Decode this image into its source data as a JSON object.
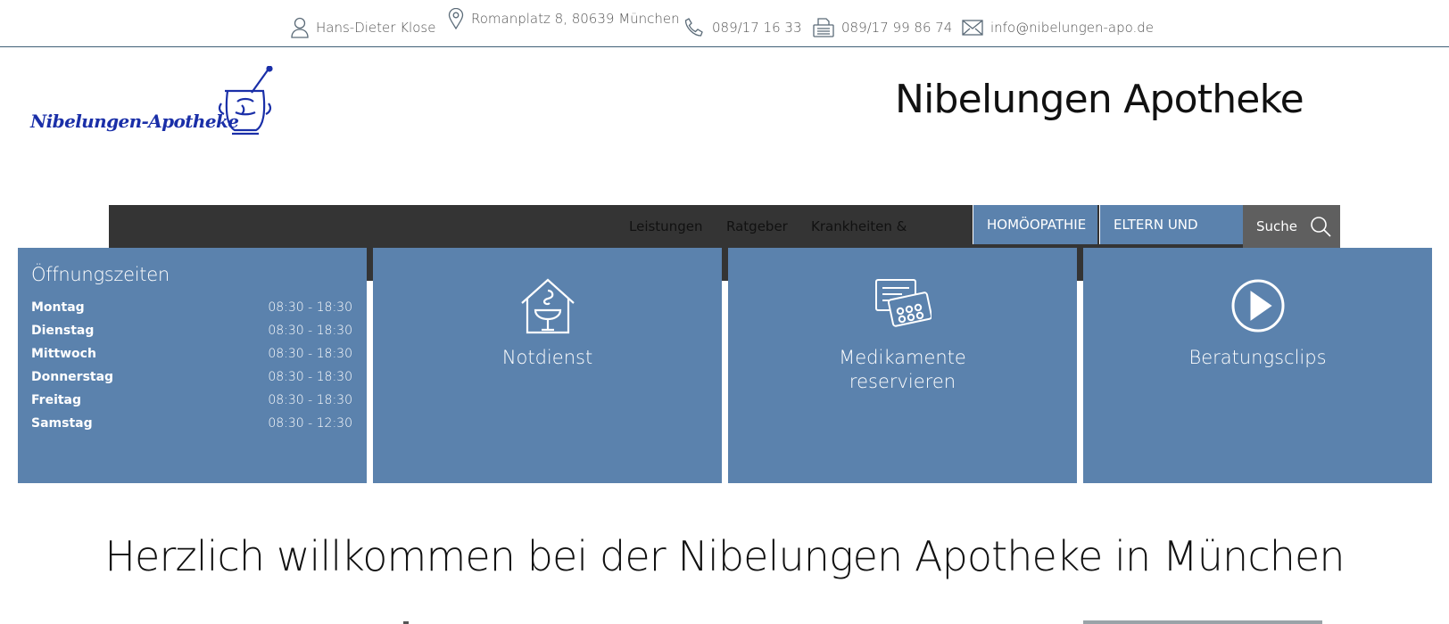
{
  "contact": {
    "name": "Hans-Dieter Klose",
    "address": "Romanplatz 8, 80639 München",
    "phone": "089/17 16 33",
    "fax": "089/17 99 86 74",
    "email": "info@nibelungen-apo.de"
  },
  "logo": {
    "text": "Nibelungen-Apotheke"
  },
  "header": {
    "title": "Nibelungen Apotheke"
  },
  "nav": {
    "links": [
      "Leistungen",
      "Ratgeber",
      "Krankheiten &"
    ],
    "tabs": [
      "HOMÖOPATHIE",
      "ELTERN UND"
    ],
    "search_label": "Suche"
  },
  "hours": {
    "title": "Öffnungszeiten",
    "rows": [
      {
        "day": "Montag",
        "time": "08:30 - 18:30"
      },
      {
        "day": "Dienstag",
        "time": "08:30 - 18:30"
      },
      {
        "day": "Mittwoch",
        "time": "08:30 - 18:30"
      },
      {
        "day": "Donnerstag",
        "time": "08:30 - 18:30"
      },
      {
        "day": "Freitag",
        "time": "08:30 - 18:30"
      },
      {
        "day": "Samstag",
        "time": "08:30 - 12:30"
      }
    ]
  },
  "tiles": {
    "notdienst": "Notdienst",
    "medikamente": "Medikamente reservieren",
    "clips": "Beratungsclips"
  },
  "welcome": {
    "heading": "Herzlich willkommen bei der Nibelungen Apotheke in München"
  },
  "colors": {
    "tile": "#5b82ad",
    "nav": "#343434",
    "search": "#5f5f5f",
    "logo": "#1a2fa8"
  }
}
